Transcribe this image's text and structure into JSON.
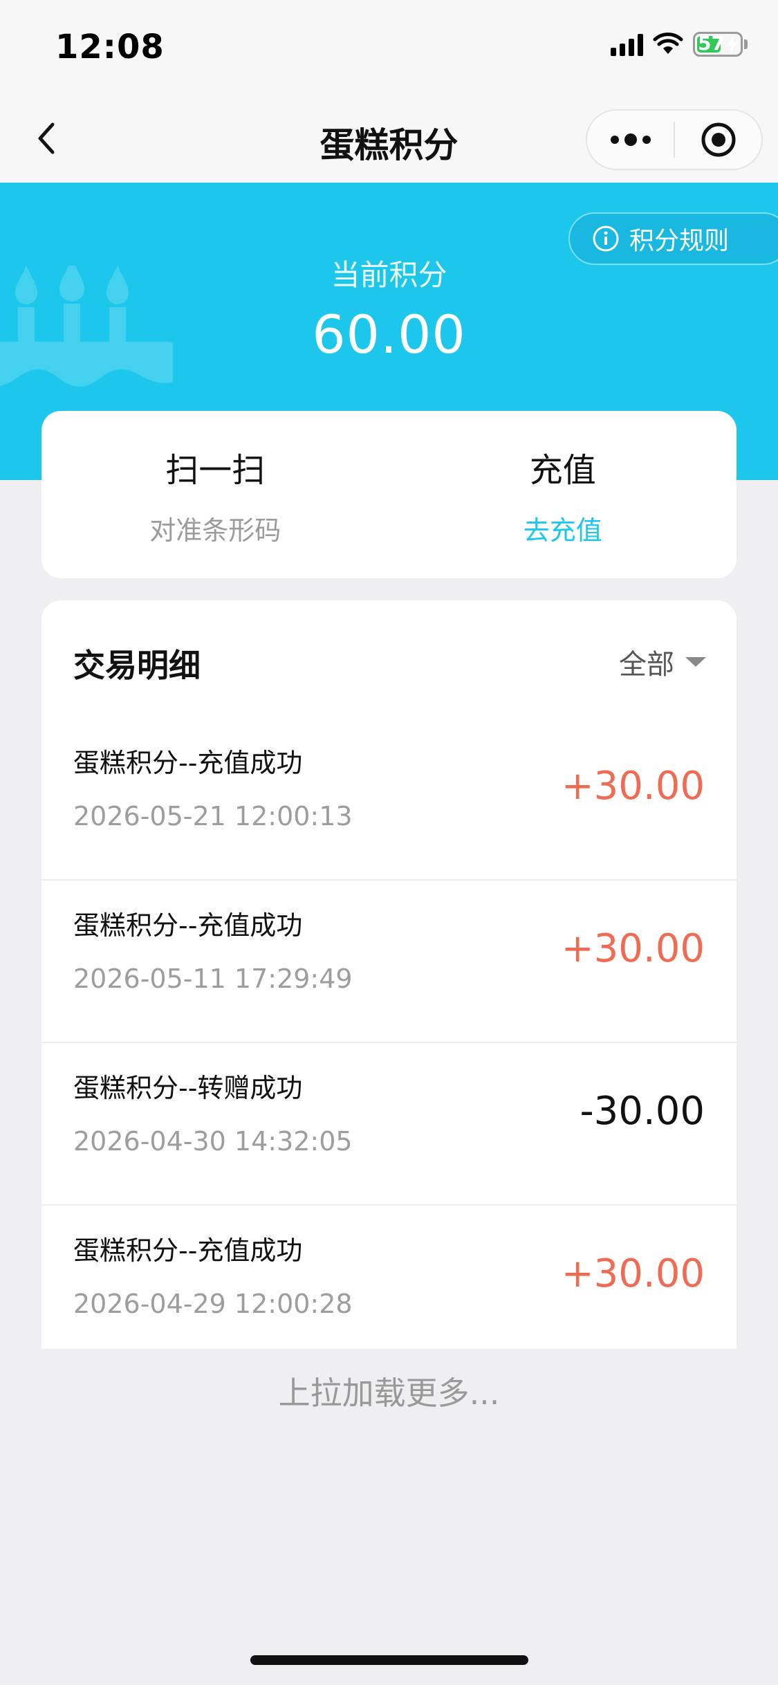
{
  "status_bar": {
    "time": "12:08",
    "battery_percent": "57",
    "battery_level": 0.57,
    "icons": [
      "signal-icon",
      "wifi-icon",
      "battery-icon",
      "charging-icon"
    ]
  },
  "nav": {
    "title": "蛋糕积分",
    "icons": [
      "back-icon",
      "more-icon",
      "target-icon"
    ]
  },
  "hero": {
    "label": "当前积分",
    "value": "60.00",
    "rules_label": "积分规则",
    "accent_color": "#1dc7ec",
    "icons": [
      "info-icon",
      "cake-icon"
    ]
  },
  "actions": {
    "scan": {
      "title": "扫一扫",
      "subtitle": "对准条形码"
    },
    "recharge": {
      "title": "充值",
      "subtitle": "去充值"
    }
  },
  "details": {
    "title": "交易明细",
    "filter_label": "全部",
    "positive_color": "#ef6b53",
    "transactions": [
      {
        "title": "蛋糕积分--充值成功",
        "time": "2026-05-21 12:00:13",
        "amount": "+30.00"
      },
      {
        "title": "蛋糕积分--充值成功",
        "time": "2026-05-11 17:29:49",
        "amount": "+30.00"
      },
      {
        "title": "蛋糕积分--转赠成功",
        "time": "2026-04-30 14:32:05",
        "amount": "-30.00"
      },
      {
        "title": "蛋糕积分--充值成功",
        "time": "2026-04-29 12:00:28",
        "amount": "+30.00"
      }
    ]
  },
  "load_more": "上拉加载更多..."
}
